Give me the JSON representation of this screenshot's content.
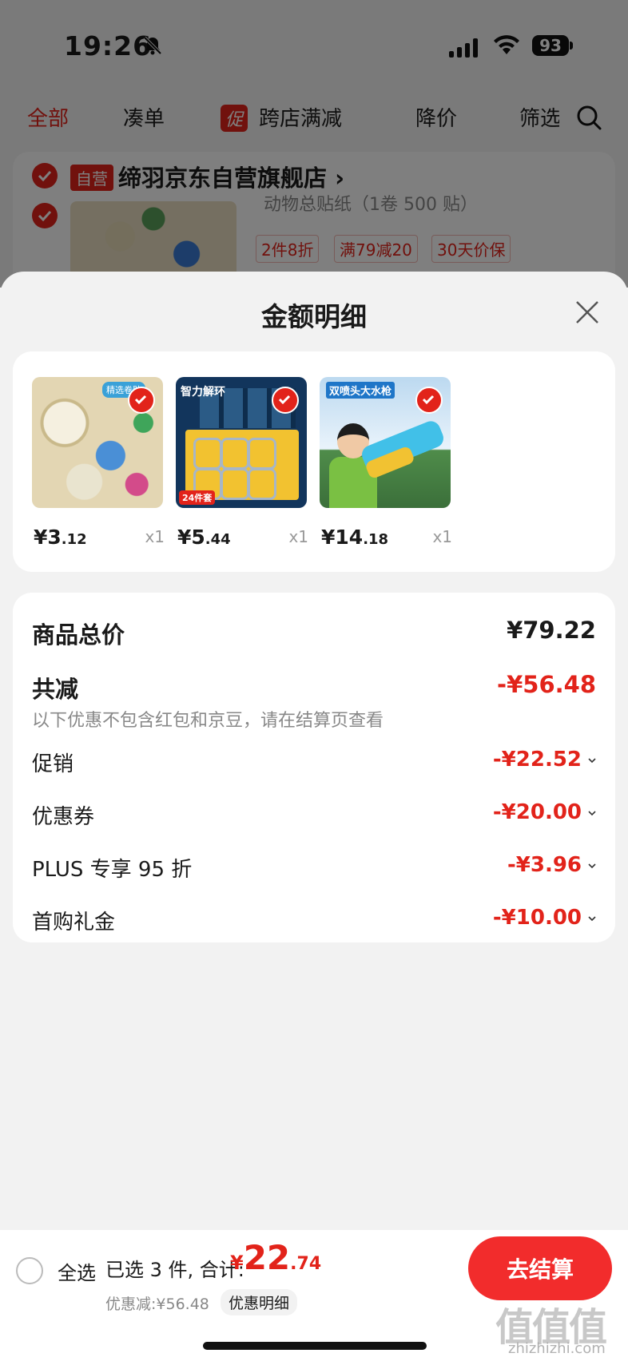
{
  "status_bar": {
    "time": "19:26",
    "battery": "93"
  },
  "top_tabs": [
    {
      "label": "全部",
      "active": true
    },
    {
      "label": "凑单",
      "active": false
    },
    {
      "label": "跨店满减",
      "badge": "促",
      "active": false
    },
    {
      "label": "降价",
      "active": false
    },
    {
      "label": "筛选",
      "active": false
    }
  ],
  "store": {
    "badge": "自营",
    "name": "缔羽京东自营旗舰店",
    "product_subtitle": "动物总贴纸（1卷 500 贴）",
    "promo_tags": [
      "2件8折",
      "满79减20",
      "30天价保"
    ]
  },
  "sheet": {
    "title": "金额明细",
    "items": [
      {
        "price_int": "¥3",
        "price_dec": ".12",
        "qty": "x1",
        "thumb_label": "精选卷贴"
      },
      {
        "price_int": "¥5",
        "price_dec": ".44",
        "qty": "x1",
        "thumb_label": "智力解环",
        "thumb_count": "24件套"
      },
      {
        "price_int": "¥14",
        "price_dec": ".18",
        "qty": "x1",
        "thumb_label": "双喷头大水枪"
      }
    ],
    "summary": {
      "total_label": "商品总价",
      "total_value": "¥79.22",
      "reduce_label": "共减",
      "reduce_value": "-¥56.48",
      "note": "以下优惠不包含红包和京豆，请在结算页查看",
      "details": [
        {
          "label": "促销",
          "value": "-¥22.52"
        },
        {
          "label": "优惠券",
          "value": "-¥20.00"
        },
        {
          "label": "PLUS 专享 95 折",
          "value": "-¥3.96"
        },
        {
          "label": "首购礼金",
          "value": "-¥10.00"
        }
      ]
    }
  },
  "bottom_bar": {
    "select_all": "全选",
    "selected_count": "已选 3 件, 合计:",
    "total_currency": "¥",
    "total_int": "22",
    "total_dec": ".74",
    "discount_text": "优惠减:¥56.48",
    "detail_link": "优惠明细",
    "checkout": "去结算"
  },
  "watermark": {
    "mark": "值值值",
    "site": "zhizhizhi.com"
  },
  "colors": {
    "accent": "#e2231a",
    "checkout": "#f22c2c"
  }
}
